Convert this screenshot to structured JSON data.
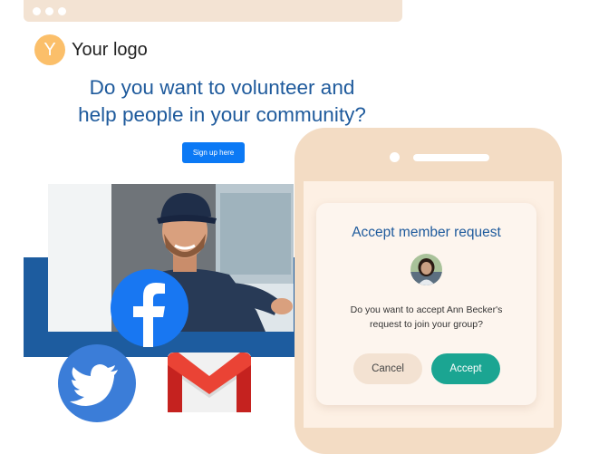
{
  "logo": {
    "initial": "Y",
    "text": "Your logo"
  },
  "hero": {
    "line1": "Do you want to volunteer and",
    "line2": "help people in your community?",
    "signup_label": "Sign up here"
  },
  "social": {
    "icons": [
      "facebook-icon",
      "twitter-icon",
      "gmail-icon"
    ]
  },
  "dialog": {
    "title": "Accept member request",
    "message_line1": "Do you want to accept Ann Becker's",
    "message_line2": "request to join your group?",
    "cancel_label": "Cancel",
    "accept_label": "Accept"
  },
  "colors": {
    "brand_blue": "#1e5a9c",
    "button_blue": "#0b79f5",
    "accept_green": "#1ba592",
    "logo_yellow": "#fbbf6a",
    "phone_beige": "#f3dcc4"
  }
}
